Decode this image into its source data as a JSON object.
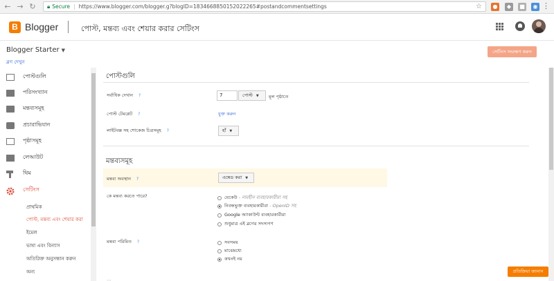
{
  "browser": {
    "secure_label": "Secure",
    "url": "https://www.blogger.com/blogger.g?blogID=1834668850152022265#postandcommentsettings"
  },
  "header": {
    "brand": "Blogger",
    "page_title": "পোস্ট, মন্তব্য এবং শেয়ার করার সেটিংস"
  },
  "blog": {
    "name": "Blogger Starter",
    "view_link": "ব্লগ দেখুন"
  },
  "toolbar": {
    "save_label": "সেটিংস সংরক্ষণ করুন"
  },
  "sidebar": {
    "items": [
      {
        "label": "পোস্টগুলি",
        "icon": "posts-icon"
      },
      {
        "label": "পরিসংখ্যান",
        "icon": "stats-icon"
      },
      {
        "label": "মন্তব্যসমূহ",
        "icon": "comments-icon"
      },
      {
        "label": "প্রচারাভিযান",
        "icon": "earnings-icon"
      },
      {
        "label": "পৃষ্ঠাসমূহ",
        "icon": "pages-icon"
      },
      {
        "label": "লেআউট",
        "icon": "layout-icon"
      },
      {
        "label": "থিম",
        "icon": "theme-icon"
      },
      {
        "label": "সেটিংস",
        "icon": "gear-icon"
      }
    ],
    "sub_items": [
      "প্রাথমিক",
      "পোস্ট, মন্তব্য এবং শেয়ার করা",
      "ইমেল",
      "ভাষা এবং বিন্যাস",
      "অতিরিক্ত অনুসন্ধান করুন",
      "অন্য"
    ]
  },
  "posts_section": {
    "title": "পোস্টগুলি",
    "show_max_label": "সর্বাধিক দেখান",
    "show_max_value": "7",
    "unit_dropdown": "পোস্ট",
    "on_home_text": "মূল পৃষ্ঠাতে",
    "template_label": "পোস্ট টেমপ্লেট",
    "template_link": "যুক্ত করুন",
    "lightbox_label": "লাইটবক্স সহ শোকেজ চিত্রসমূহ",
    "lightbox_value": "হাঁ"
  },
  "comments_section": {
    "title": "মন্তব্যসমূহ",
    "location_label": "মন্তব্য অবস্থান",
    "location_value": "এম্বেড করা",
    "who_label": "কে মন্তব্য করতে পারে?",
    "who_options": [
      {
        "text": "যেকেউ",
        "note": "- নামহীন ব্যবহারকারীরা সহ",
        "checked": false
      },
      {
        "text": "নিবন্ধভুক্ত ব্যবহারকারীরা",
        "note": "- OpenID সহ",
        "checked": true
      },
      {
        "text": "Google অ্যাকাউন্ট ব্যবহারকারীরা",
        "note": "",
        "checked": false
      },
      {
        "text": "শুধুমাত্র এই ব্লগের সদস্যগণ",
        "note": "",
        "checked": false
      }
    ],
    "moderation_label": "মন্তব্য পরিমিত",
    "moderation_options": [
      {
        "text": "সবসময়",
        "checked": false
      },
      {
        "text": "মাঝেমধ্যে",
        "checked": false
      },
      {
        "text": "কখনই নয়",
        "checked": true
      }
    ]
  },
  "feedback_label": "প্রতিক্রিয়া জানান",
  "colors": {
    "accent": "#f57d00",
    "active": "#dd4b39",
    "link": "#3367d6",
    "highlight": "#fff8e5"
  }
}
